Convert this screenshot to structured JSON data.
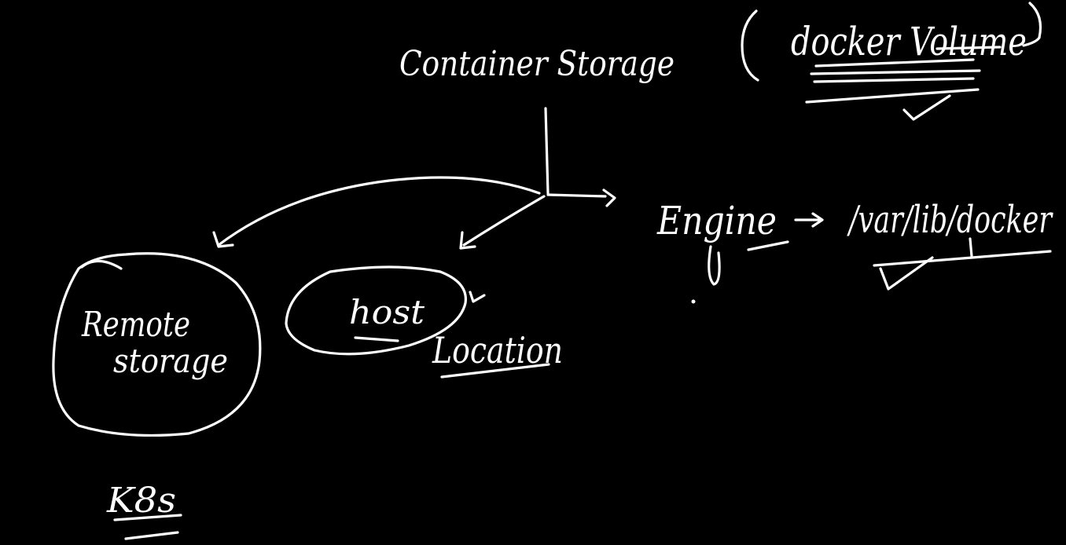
{
  "colors": {
    "background": "#000000",
    "ink": "#ffffff"
  },
  "labels": {
    "container_storage": "Container Storage",
    "docker_volume": "docker Volume",
    "engine": "Engine",
    "engine_path": "/var/lib/docker",
    "remote_storage_line1": "Remote",
    "remote_storage_line2": "storage",
    "host": "host",
    "location": "Location",
    "k8s": "K8s"
  }
}
